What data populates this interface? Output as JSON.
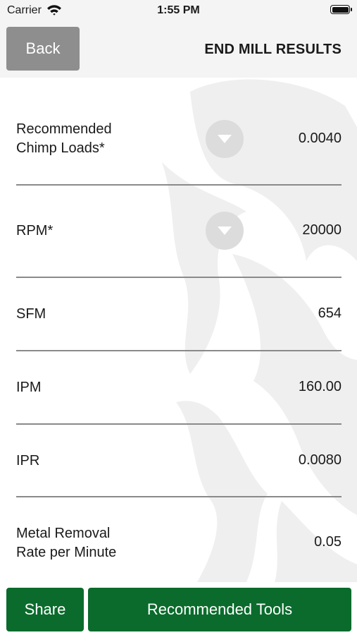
{
  "status_bar": {
    "carrier": "Carrier",
    "time": "1:55 PM"
  },
  "nav": {
    "back_label": "Back",
    "title": "END MILL RESULTS"
  },
  "results": [
    {
      "label_line1": "Recommended",
      "label_line2": "Chimp Loads*",
      "value": "0.0040",
      "has_dropdown": true
    },
    {
      "label_line1": "RPM*",
      "value": "20000",
      "has_dropdown": true
    },
    {
      "label_line1": "SFM",
      "value": "654"
    },
    {
      "label_line1": "IPM",
      "value": "160.00"
    },
    {
      "label_line1": "IPR",
      "value": "0.0080"
    },
    {
      "label_line1": "Metal Removal",
      "label_line2": "Rate per Minute",
      "value": "0.05"
    }
  ],
  "footer": {
    "share_label": "Share",
    "tools_label": "Recommended Tools"
  },
  "colors": {
    "primary_green": "#0a6b2c",
    "back_gray": "#8e8e8e",
    "dropdown_gray": "#dcdcdc"
  },
  "icons": {
    "dropdown": "chevron-down-icon",
    "wifi": "wifi-icon",
    "battery": "battery-icon"
  }
}
